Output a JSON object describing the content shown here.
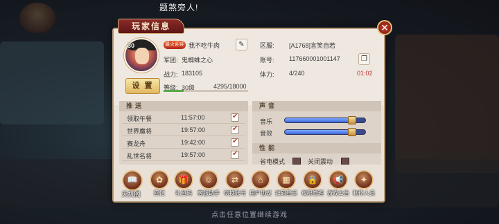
{
  "background": {
    "top_banner": "题煞旁人!",
    "bottom_hint": "点击任意位置继续游戏"
  },
  "panel": {
    "title": "玩家信息",
    "close_icon": "close-icon",
    "accent_color": "#8b2b2b"
  },
  "profile": {
    "avatar_level": "30",
    "name_badge": "最火迎迎",
    "name": "我不吃牛肉",
    "guild_label": "军团:",
    "guild_value": "鬼蜘蛛之心",
    "power_label": "战力:",
    "power_value": "183105",
    "settings_label": "设 置",
    "level_label": "等级:",
    "level_value": "30级",
    "xp_text": "4295/18000",
    "xp_fraction": 0.2386,
    "server_label": "区服:",
    "server_value": "[A1768]言笑自若",
    "account_label": "账号:",
    "account_value": "117660001001147",
    "stamina_label": "体力:",
    "stamina_value": "4/240",
    "stamina_timer": "01:02"
  },
  "push": {
    "header": "推送",
    "items": [
      {
        "label": "领取午餐",
        "time": "11:57:00",
        "checked": true
      },
      {
        "label": "世界魔将",
        "time": "19:57:00",
        "checked": true
      },
      {
        "label": "赛龙舟",
        "time": "19:42:00",
        "checked": true
      },
      {
        "label": "乱世名将",
        "time": "19:57:00",
        "checked": true
      }
    ]
  },
  "sound": {
    "header": "声音",
    "music_label": "音乐",
    "music_level": 0.82,
    "sfx_label": "音效",
    "sfx_level": 0.82
  },
  "performance": {
    "header": "性能",
    "power_save_label": "省电模式",
    "vibration_label": "关闭震动"
  },
  "toolbar": [
    {
      "label": "天机阁",
      "icon": "book-icon"
    },
    {
      "label": "回忆",
      "icon": "leaf-icon"
    },
    {
      "label": "礼包码",
      "icon": "gift-icon"
    },
    {
      "label": "客服助手",
      "icon": "support-icon"
    },
    {
      "label": "切换账号",
      "icon": "switch-icon"
    },
    {
      "label": "用户协议",
      "icon": "home-icon"
    },
    {
      "label": "扫码登录",
      "icon": "scan-icon"
    },
    {
      "label": "权限管理",
      "icon": "lock-icon"
    },
    {
      "label": "游戏公告",
      "icon": "megaphone-icon"
    },
    {
      "label": "制作人员",
      "icon": "rabbit-icon"
    }
  ]
}
